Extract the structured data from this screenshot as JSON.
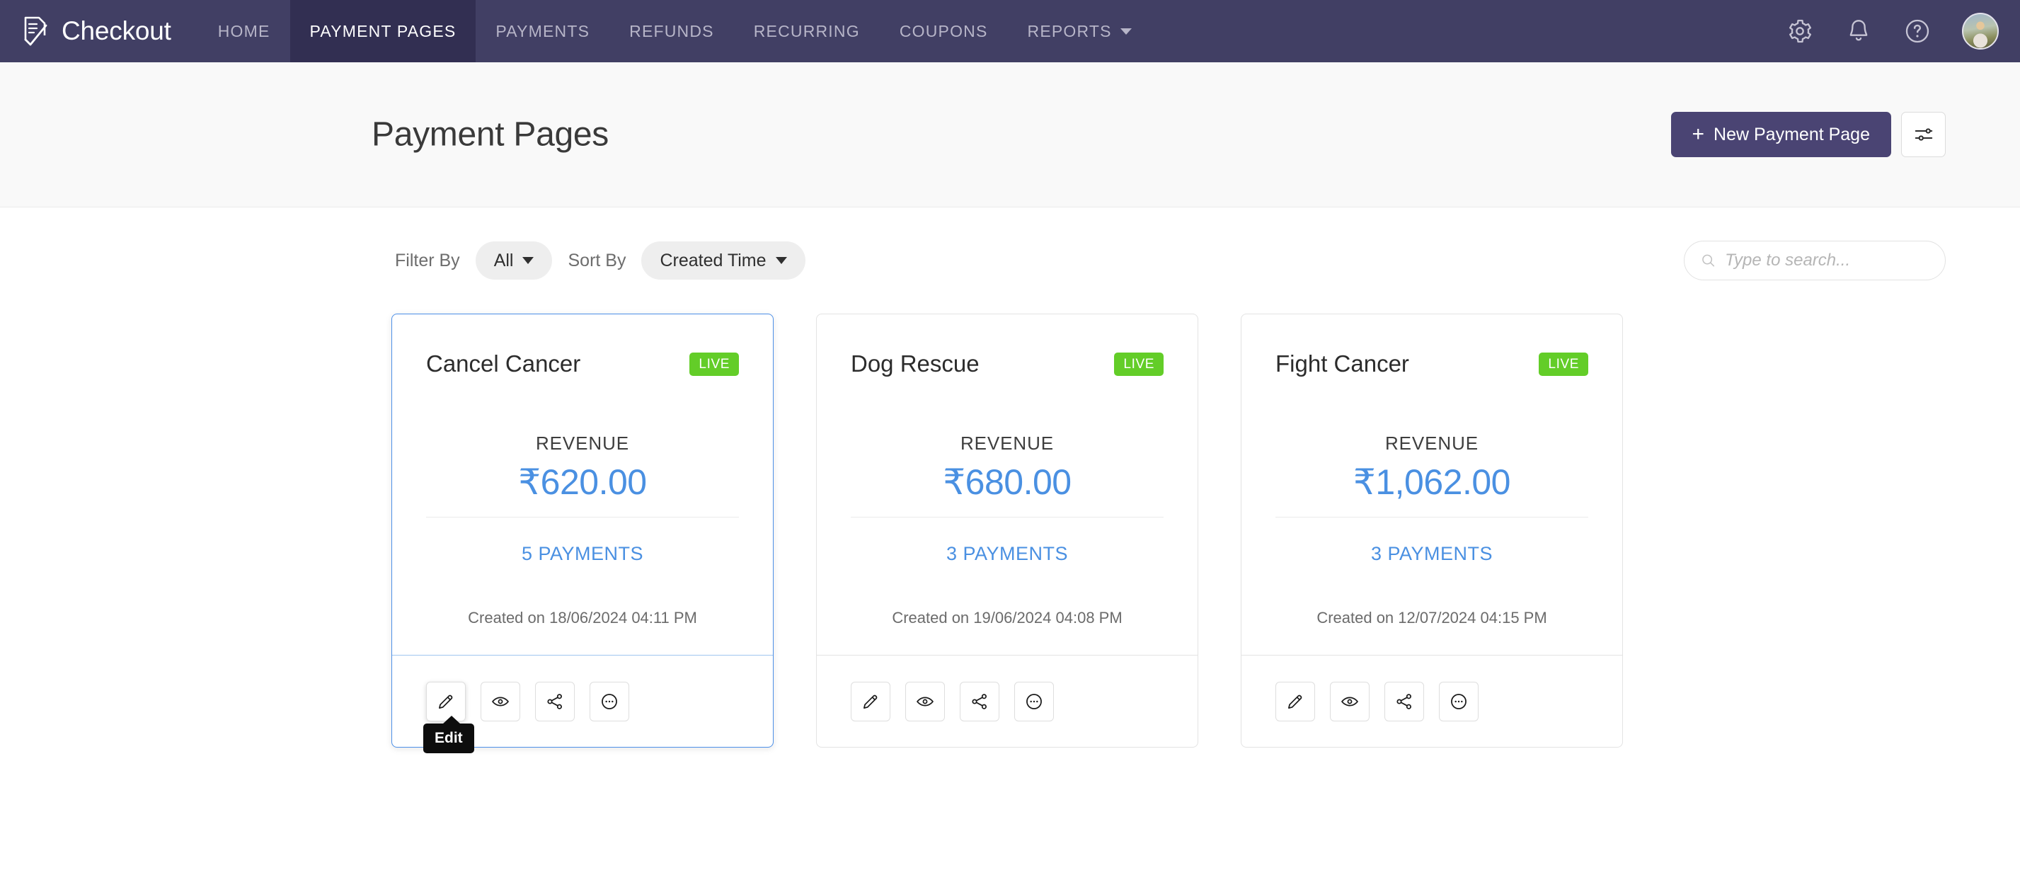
{
  "navbar": {
    "brand": "Checkout",
    "links": [
      {
        "label": "HOME",
        "active": false,
        "caret": false
      },
      {
        "label": "PAYMENT PAGES",
        "active": true,
        "caret": false
      },
      {
        "label": "PAYMENTS",
        "active": false,
        "caret": false
      },
      {
        "label": "REFUNDS",
        "active": false,
        "caret": false
      },
      {
        "label": "RECURRING",
        "active": false,
        "caret": false
      },
      {
        "label": "COUPONS",
        "active": false,
        "caret": false
      },
      {
        "label": "REPORTS",
        "active": false,
        "caret": true
      }
    ],
    "icons": [
      "gear-icon",
      "bell-icon",
      "help-icon",
      "avatar"
    ]
  },
  "header": {
    "title": "Payment Pages",
    "new_page_button": "New Payment Page",
    "new_page_plus": "+",
    "settings_button_icon": "sliders-icon"
  },
  "filters": {
    "filter_by_label": "Filter By",
    "filter_by_value": "All",
    "sort_by_label": "Sort By",
    "sort_by_value": "Created Time",
    "search_placeholder": "Type to search..."
  },
  "cards": [
    {
      "name": "Cancel Cancer",
      "status": "LIVE",
      "revenue_label": "REVENUE",
      "revenue_amount": "₹620.00",
      "payments": "5 PAYMENTS",
      "created": "Created on 18/06/2024 04:11 PM",
      "highlighted": true,
      "tooltip": "Edit"
    },
    {
      "name": "Dog Rescue",
      "status": "LIVE",
      "revenue_label": "REVENUE",
      "revenue_amount": "₹680.00",
      "payments": "3 PAYMENTS",
      "created": "Created on 19/06/2024 04:08 PM",
      "highlighted": false,
      "tooltip": null
    },
    {
      "name": "Fight Cancer",
      "status": "LIVE",
      "revenue_label": "REVENUE",
      "revenue_amount": "₹1,062.00",
      "payments": "3 PAYMENTS",
      "created": "Created on 12/07/2024 04:15 PM",
      "highlighted": false,
      "tooltip": null
    }
  ],
  "card_actions": [
    "edit-icon",
    "preview-icon",
    "share-icon",
    "more-icon"
  ],
  "colors": {
    "navbar_bg": "#413f64",
    "navbar_active_bg": "#322f52",
    "primary_button": "#4a4473",
    "live_badge": "#63cd28",
    "accent_blue": "#4a90e2",
    "highlight_border": "#4d90e8",
    "header_bg": "#f9f9f9"
  }
}
